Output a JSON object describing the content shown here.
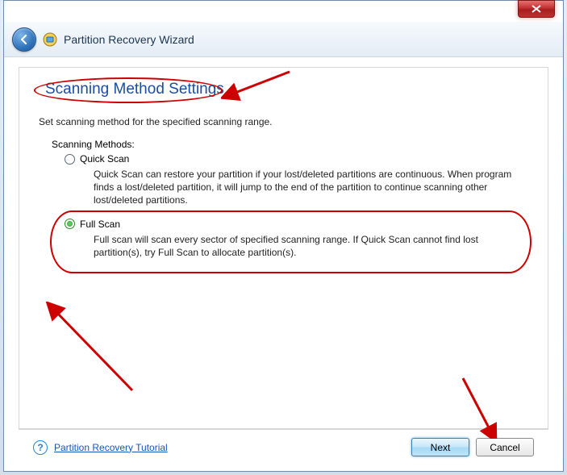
{
  "window": {
    "title": "Partition Recovery Wizard",
    "close_icon": "close-icon"
  },
  "page": {
    "heading": "Scanning Method Settings",
    "subtitle": "Set scanning method for the specified scanning range.",
    "group_label": "Scanning Methods:"
  },
  "options": {
    "quick": {
      "label": "Quick Scan",
      "desc": "Quick Scan can restore your partition if your lost/deleted partitions are continuous. When program finds a lost/deleted partition, it will jump to the end of the partition to continue scanning other lost/deleted partitions.",
      "selected": false
    },
    "full": {
      "label": "Full Scan",
      "desc": "Full scan will scan every sector of specified scanning range. If Quick Scan cannot find lost partition(s), try Full Scan to allocate partition(s).",
      "selected": true
    }
  },
  "footer": {
    "tutorial_link": "Partition Recovery Tutorial",
    "next": "Next",
    "cancel": "Cancel"
  }
}
